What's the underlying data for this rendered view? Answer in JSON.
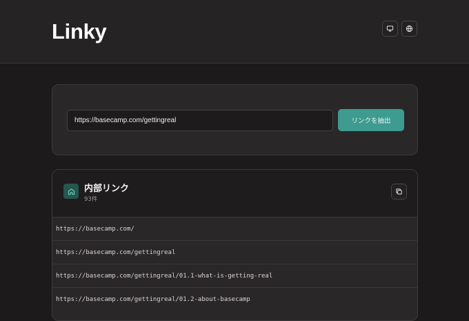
{
  "header": {
    "logo": "Linky",
    "buttons": [
      {
        "name": "display-mode",
        "icon": "monitor-icon"
      },
      {
        "name": "language",
        "icon": "globe-icon"
      }
    ]
  },
  "extract": {
    "input_value": "https://basecamp.com/gettingreal",
    "button_label": "リンクを抽出"
  },
  "internal_links": {
    "icon": "home-icon",
    "title": "内部リンク",
    "count": "93件",
    "copy_icon": "copy-icon",
    "links": [
      "https://basecamp.com/",
      "https://basecamp.com/gettingreal",
      "https://basecamp.com/gettingreal/01.1-what-is-getting-real",
      "https://basecamp.com/gettingreal/01.2-about-basecamp"
    ]
  },
  "colors": {
    "accent": "#3d9b8f",
    "background": "#1c1a1b",
    "header_bg": "#252324",
    "card_bg": "#2a2728"
  }
}
